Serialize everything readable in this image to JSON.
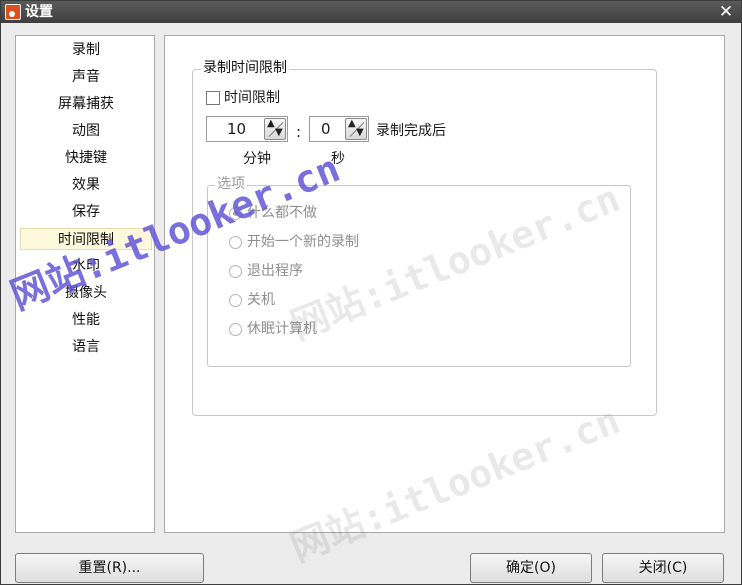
{
  "window": {
    "title": "设置"
  },
  "sidebar": {
    "items": [
      {
        "label": "录制"
      },
      {
        "label": "声音"
      },
      {
        "label": "屏幕捕获"
      },
      {
        "label": "动图"
      },
      {
        "label": "快捷键"
      },
      {
        "label": "效果"
      },
      {
        "label": "保存"
      },
      {
        "label": "时间限制",
        "selected": true
      },
      {
        "label": "水印"
      },
      {
        "label": "摄像头"
      },
      {
        "label": "性能"
      },
      {
        "label": "语言"
      }
    ]
  },
  "time_limit": {
    "group_title": "录制时间限制",
    "enable_label": "时间限制",
    "enable_checked": false,
    "minutes_value": "10",
    "seconds_value": "0",
    "separator": ":",
    "minutes_unit": "分钟",
    "seconds_unit": "秒",
    "after_label": "录制完成后",
    "options_title": "选项",
    "options": [
      {
        "label": "什么都不做",
        "checked": true
      },
      {
        "label": "开始一个新的录制",
        "checked": false
      },
      {
        "label": "退出程序",
        "checked": false
      },
      {
        "label": "关机",
        "checked": false
      },
      {
        "label": "休眠计算机",
        "checked": false
      }
    ]
  },
  "buttons": {
    "reset": "重置(R)...",
    "ok": "确定(O)",
    "close": "关闭(C)"
  },
  "watermark": {
    "text": "网站:itlooker.cn"
  },
  "colors": {
    "titlebar": "#4a4a4a",
    "selected_bg": "#fdf7dc",
    "watermark_strong": "#5b4fd6"
  }
}
